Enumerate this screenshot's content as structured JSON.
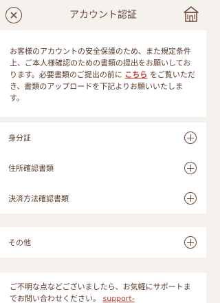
{
  "header": {
    "title": "アカウント認証"
  },
  "intro": {
    "text_before": "お客様のアカウントの安全保護のため、また規定条件上、ご本人様確認のための書類の提出をお願いしております。必要書類のご提出の前に ",
    "link": "こちら",
    "text_after": " をご覧いただき、書類のアップロードを下記よりお願いいたします。"
  },
  "documents": [
    {
      "label": "身分証"
    },
    {
      "label": "住所確認書類"
    },
    {
      "label": "決済方法確認書類"
    }
  ],
  "other": {
    "label": "その他"
  },
  "footer": {
    "text": "ご不明な点などございましたら、お気軽にサポートまでお問い合わせください。 ",
    "link": "support-"
  }
}
